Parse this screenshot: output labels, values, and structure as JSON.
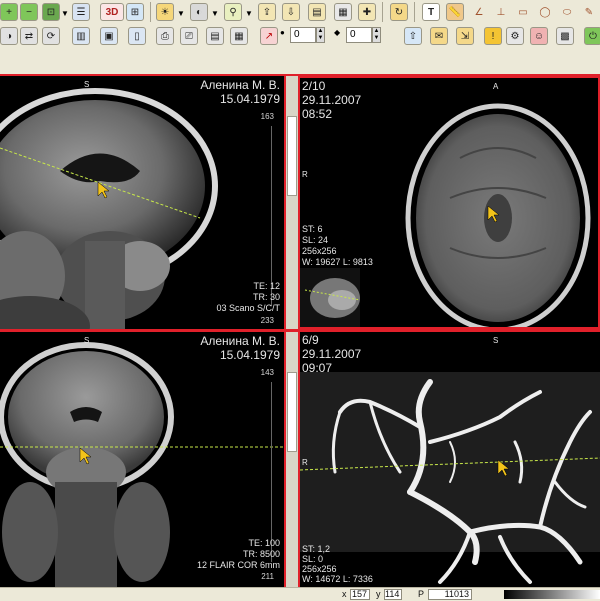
{
  "toolbar": {
    "row1_buttons": [
      "zoom-in-icon",
      "zoom-out-icon",
      "fit-icon",
      "menu-arrow-icon",
      "layout-icon",
      "3d-icon",
      "grid-icon",
      "window-level-icon",
      "menu-arrow-icon",
      "contrast-icon",
      "menu-arrow-icon",
      "magnifier-icon",
      "menu-arrow-icon",
      "export-icon",
      "import-icon",
      "series-icon",
      "dicom-icon",
      "refresh-icon",
      "text-icon",
      "ruler-icon",
      "angle-icon",
      "cobb-icon",
      "roi-icon",
      "lasso-icon",
      "ellipse-icon",
      "freehand-icon",
      "exit-icon"
    ],
    "row2_buttons": [
      "invert-icon",
      "flip-icon",
      "rotate-icon",
      "grid2-icon",
      "screen-icon",
      "print-icon",
      "print-preview-icon",
      "film-icon"
    ],
    "labels": {
      "three_d": "3D",
      "text_tool": "T",
      "spin1_value": "0",
      "spin2_value": "0"
    }
  },
  "panes": [
    {
      "id": "sagittal",
      "top_label": "S",
      "patient_name": "Аленина М. В.",
      "patient_dob": "15.04.1979",
      "scale_top": "163",
      "scale_bottom": "233",
      "info_lines": [
        "TE: 12",
        "TR: 30",
        "03 Scano S/C/T"
      ]
    },
    {
      "id": "axial",
      "image_index": "2/10",
      "study_date": "29.11.2007",
      "study_time": "08:52",
      "top_label": "A",
      "side_label": "R",
      "params": [
        "ST: 6",
        "SL: 24",
        "256x256",
        "W: 19627 L: 9813"
      ]
    },
    {
      "id": "coronal",
      "top_label": "S",
      "patient_name": "Аленина М. В.",
      "patient_dob": "15.04.1979",
      "scale_top": "143",
      "scale_bottom": "211",
      "info_lines": [
        "TE: 100",
        "TR: 8500",
        "12 FLAIR COR 6mm"
      ]
    },
    {
      "id": "angio",
      "image_index": "6/9",
      "study_date": "29.11.2007",
      "study_time": "09:07",
      "top_label": "S",
      "side_label": "R",
      "params": [
        "ST: 1,2",
        "SL: 0",
        "256x256",
        "W: 14672 L: 7336"
      ]
    }
  ],
  "statusbar": {
    "x_label": "x",
    "x_value": "157",
    "y_label": "y",
    "y_value": "114",
    "p_label": "P",
    "p_value": "11013"
  },
  "colors": {
    "toolbar_bg": "#ece9d8",
    "active_border": "#e0202a",
    "reference_line": "#c8e84a",
    "cursor": "#f2c31a"
  }
}
